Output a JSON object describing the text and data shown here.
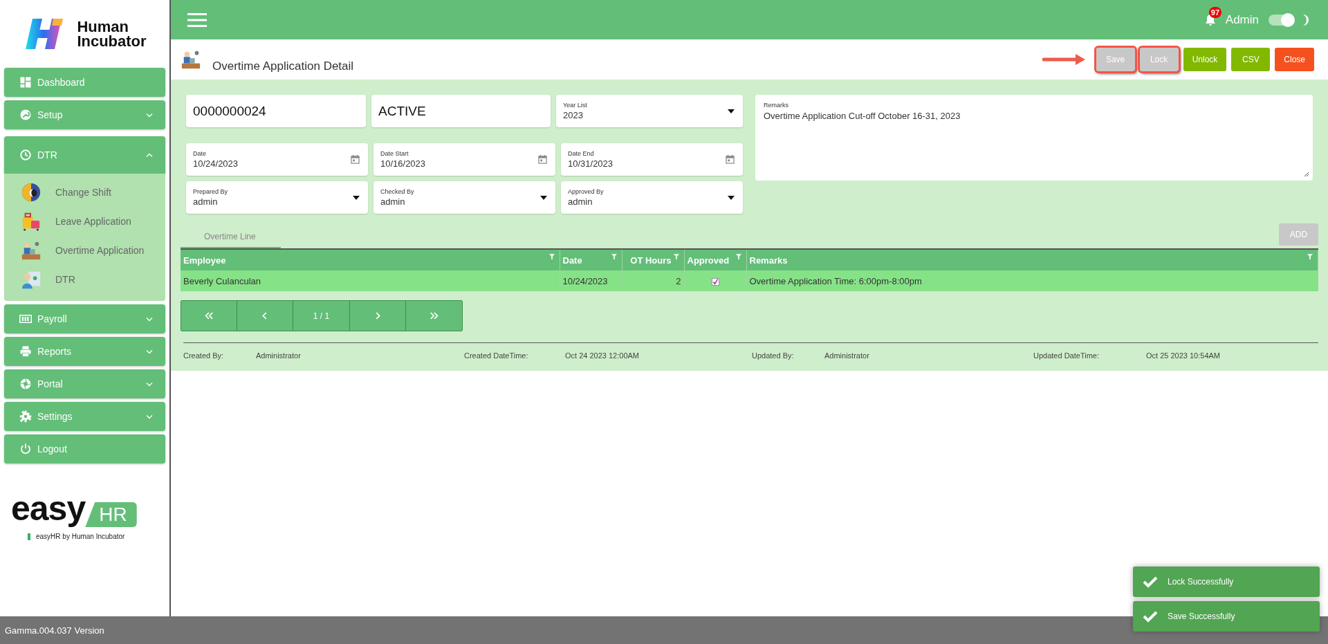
{
  "brand": {
    "name_line1": "Human",
    "name_line2": "Incubator"
  },
  "sidebar": {
    "items": [
      {
        "label": "Dashboard",
        "kind": "link"
      },
      {
        "label": "Setup",
        "kind": "group",
        "expanded": false
      },
      {
        "label": "DTR",
        "kind": "group",
        "expanded": true,
        "children": [
          {
            "label": "Change Shift"
          },
          {
            "label": "Leave Application"
          },
          {
            "label": "Overtime Application"
          },
          {
            "label": "DTR"
          }
        ]
      },
      {
        "label": "Payroll",
        "kind": "group",
        "expanded": false
      },
      {
        "label": "Reports",
        "kind": "group",
        "expanded": false
      },
      {
        "label": "Portal",
        "kind": "group",
        "expanded": false
      },
      {
        "label": "Settings",
        "kind": "group",
        "expanded": false
      },
      {
        "label": "Logout",
        "kind": "link"
      }
    ],
    "footer_logo": {
      "word": "easy",
      "tag": "HR",
      "tagline": "easyHR by Human Incubator"
    }
  },
  "header": {
    "notification_count": "97",
    "user": "Admin",
    "dark_mode": {
      "on": true
    }
  },
  "page": {
    "title": "Overtime Application Detail",
    "buttons": [
      {
        "label": "Save",
        "kind": "success",
        "disabled": true,
        "highlighted": true
      },
      {
        "label": "Lock",
        "kind": "success",
        "disabled": true,
        "highlighted": true
      },
      {
        "label": "Unlock",
        "kind": "success",
        "disabled": false,
        "highlighted": false
      },
      {
        "label": "CSV",
        "kind": "success",
        "disabled": false,
        "highlighted": false
      },
      {
        "label": "Close",
        "kind": "danger",
        "disabled": false,
        "highlighted": false
      }
    ]
  },
  "form": {
    "top": [
      {
        "kind": "plain",
        "value": "0000000024"
      },
      {
        "kind": "plain",
        "value": "ACTIVE"
      },
      {
        "kind": "select",
        "label": "Year List",
        "value": "2023"
      }
    ],
    "rows": [
      {
        "kind": "date",
        "label": "Date",
        "value": "10/24/2023"
      },
      {
        "kind": "date",
        "label": "Date Start",
        "value": "10/16/2023"
      },
      {
        "kind": "date",
        "label": "Date End",
        "value": "10/31/2023"
      },
      {
        "kind": "select",
        "label": "Prepared By",
        "value": "admin"
      },
      {
        "kind": "select",
        "label": "Checked By",
        "value": "admin"
      },
      {
        "kind": "select",
        "label": "Approved By",
        "value": "admin"
      }
    ],
    "remarks": {
      "label": "Remarks",
      "value": "Overtime Application Cut-off October 16-31, 2023"
    }
  },
  "tabs": [
    {
      "label": "Overtime Line",
      "selected": true
    }
  ],
  "add_button": {
    "label": "ADD",
    "disabled": true
  },
  "table": {
    "columns": [
      "Employee",
      "Date",
      "OT Hours",
      "Approved",
      "Remarks"
    ],
    "rows": [
      {
        "employee": "Beverly Culanculan",
        "date": "10/24/2023",
        "ot_hours": "2",
        "approved": true,
        "remarks": "Overtime Application Time: 6:00pm-8:00pm",
        "selected": true
      }
    ]
  },
  "pagination": {
    "page": "1 / 1"
  },
  "audit": [
    {
      "label": "Created By:",
      "value": "Administrator"
    },
    {
      "label": "Created DateTime:",
      "value": "Oct 24 2023 12:00AM"
    },
    {
      "label": "Updated By:",
      "value": "Administrator"
    },
    {
      "label": "Updated DateTime:",
      "value": "Oct 25 2023 10:54AM"
    }
  ],
  "status_bar": {
    "version": "Gamma.004.037 Version"
  },
  "toasts": [
    {
      "message": "Lock Successfully"
    },
    {
      "message": "Save Successfully"
    }
  ]
}
